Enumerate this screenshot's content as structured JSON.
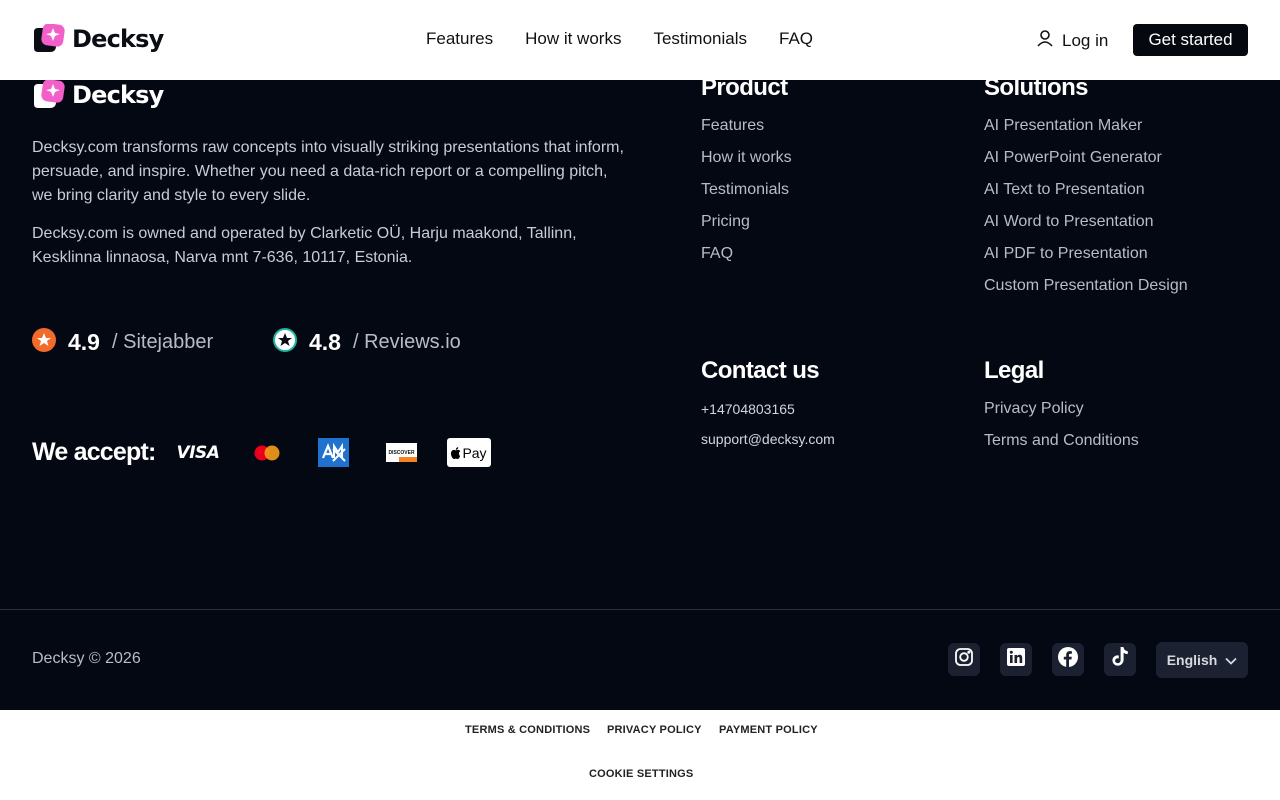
{
  "header": {
    "logo_text": "Decksy",
    "nav": [
      "Features",
      "How it works",
      "Testimonials",
      "FAQ"
    ],
    "login": "Log in",
    "cta": "Get started"
  },
  "footer": {
    "logo_text": "Decksy",
    "description": "Decksy.com transforms raw concepts into visually striking presentations that inform, persuade, and inspire. Whether you need a data-rich report or a compelling pitch, we bring clarity and style to every slide.",
    "ownership": "Decksy.com is owned and operated by Clarketic OÜ, Harju maakond, Tallinn, Kesklinna linnaosa, Narva mnt 7-636, 10117, Estonia.",
    "ratings": [
      {
        "score": "4.9",
        "source": "/ Sitejabber"
      },
      {
        "score": "4.8",
        "source": "/ Reviews.io"
      }
    ],
    "accept_label": "We accept:",
    "payment_methods": {
      "visa": "VISA",
      "discover": "DISCOVER",
      "applepay": "Pay"
    },
    "product": {
      "title": "Product",
      "links": [
        "Features",
        "How it works",
        "Testimonials",
        "Pricing",
        "FAQ"
      ]
    },
    "solutions": {
      "title": "Solutions",
      "links": [
        "AI Presentation Maker",
        "AI PowerPoint Generator",
        "AI Text to Presentation",
        "AI Word to Presentation",
        "AI PDF to Presentation",
        "Custom Presentation Design"
      ]
    },
    "contact": {
      "title": "Contact us",
      "phone": "+14704803165",
      "email": "support@decksy.com"
    },
    "legal": {
      "title": "Legal",
      "links": [
        "Privacy Policy",
        "Terms and Conditions"
      ]
    },
    "copyright": "Decksy © 2026",
    "language": "English"
  },
  "legal_bar": {
    "terms": "TERMS & CONDITIONS",
    "privacy": "PRIVACY POLICY",
    "payment": "PAYMENT POLICY",
    "cookies": "COOKIE SETTINGS"
  },
  "colors": {
    "brand_pink": "#f25fc8",
    "footer_bg": "#040812",
    "rating_orange": "#f26b2a"
  }
}
